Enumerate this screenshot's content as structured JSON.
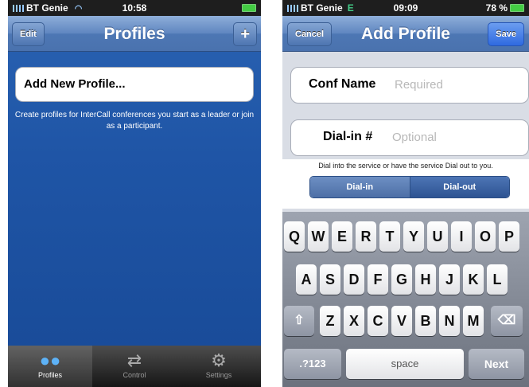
{
  "left_screen": {
    "status": {
      "carrier": "BT Genie",
      "time": "10:58"
    },
    "nav": {
      "title": "Profiles",
      "edit_label": "Edit",
      "add_label": "+"
    },
    "add_profile_label": "Add New Profile...",
    "hint": "Create profiles for InterCall conferences you start as a leader or join as a participant.",
    "tabs": [
      {
        "label": "Profiles",
        "icon": "people-icon"
      },
      {
        "label": "Control",
        "icon": "arrows-icon"
      },
      {
        "label": "Settings",
        "icon": "gear-icon"
      }
    ]
  },
  "right_screen": {
    "status": {
      "carrier": "BT Genie",
      "network": "E",
      "time": "09:09",
      "battery": "78 %"
    },
    "nav": {
      "title": "Add Profile",
      "cancel_label": "Cancel",
      "save_label": "Save"
    },
    "conf_name": {
      "label": "Conf Name",
      "placeholder": "Required"
    },
    "dial_in": {
      "label": "Dial-in #",
      "placeholder": "Optional"
    },
    "dial_hint": "Dial into the service or have the service Dial out to you.",
    "segment": {
      "options": [
        "Dial-in",
        "Dial-out"
      ]
    },
    "keyboard": {
      "row1": [
        "Q",
        "W",
        "E",
        "R",
        "T",
        "Y",
        "U",
        "I",
        "O",
        "P"
      ],
      "row2": [
        "A",
        "S",
        "D",
        "F",
        "G",
        "H",
        "J",
        "K",
        "L"
      ],
      "row3": [
        "Z",
        "X",
        "C",
        "V",
        "B",
        "N",
        "M"
      ],
      "numbers_label": ".?123",
      "space_label": "space",
      "next_label": "Next"
    }
  },
  "colors": {
    "nav_blue": "#4a72ae",
    "body_blue": "#1f55a6",
    "save_blue": "#2f6ae0",
    "tab_active": "#5db2f7"
  }
}
